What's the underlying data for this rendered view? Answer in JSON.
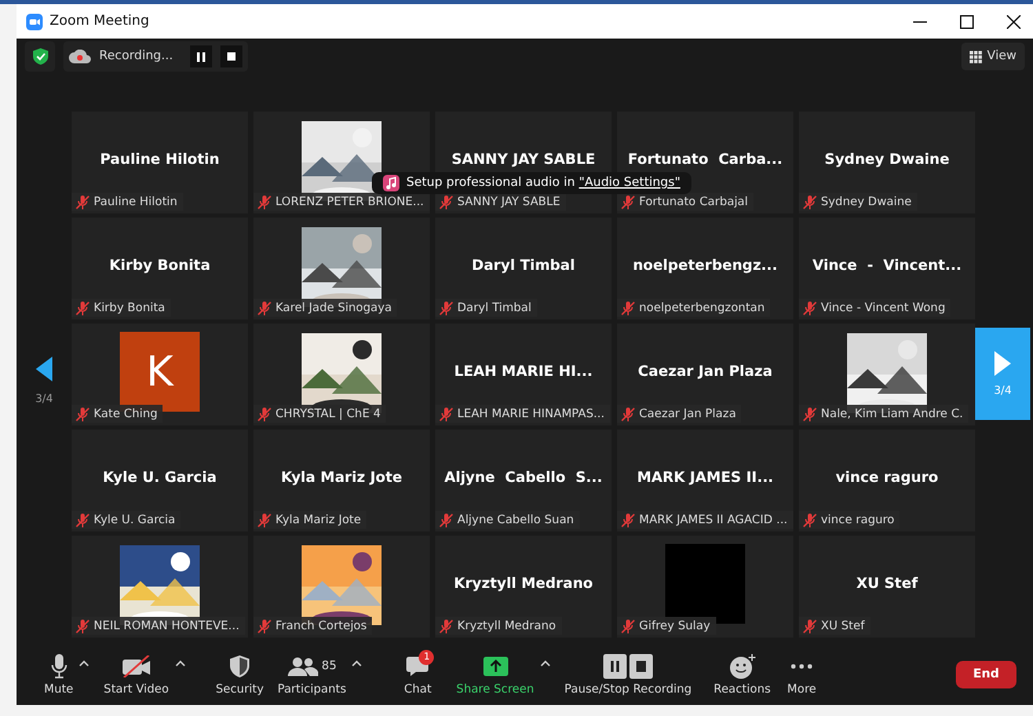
{
  "window": {
    "title": "Zoom Meeting"
  },
  "top_bar": {
    "recording": "Recording...",
    "view": "View"
  },
  "tooltip": {
    "text": "Setup professional audio in ",
    "link": "\"Audio Settings\""
  },
  "pager": {
    "left": "3/4",
    "right": "3/4"
  },
  "tiles": [
    {
      "kind": "name",
      "display_name": "Pauline Hilotin",
      "label": "Pauline Hilotin",
      "muted": true
    },
    {
      "kind": "picture",
      "label": "LORENZ PETER BRIONE...",
      "muted": true
    },
    {
      "kind": "name",
      "display_name": "SANNY JAY SABLE",
      "label": "SANNY JAY SABLE",
      "muted": true
    },
    {
      "kind": "name",
      "display_name": "Fortunato  Carba...",
      "label": "Fortunato Carbajal",
      "muted": true
    },
    {
      "kind": "name",
      "display_name": "Sydney Dwaine",
      "label": "Sydney Dwaine",
      "muted": true
    },
    {
      "kind": "name",
      "display_name": "Kirby Bonita",
      "label": "Kirby Bonita",
      "muted": true
    },
    {
      "kind": "picture",
      "label": "Karel Jade Sinogaya",
      "muted": true
    },
    {
      "kind": "name",
      "display_name": "Daryl Timbal",
      "label": "Daryl Timbal",
      "muted": true
    },
    {
      "kind": "name",
      "display_name": "noelpeterbengz...",
      "label": "noelpeterbengzontan",
      "muted": true
    },
    {
      "kind": "name",
      "display_name": "Vince  -  Vincent...",
      "label": "Vince - Vincent Wong",
      "muted": true
    },
    {
      "kind": "letter",
      "avatar_letter": "K",
      "label": "Kate Ching",
      "muted": true
    },
    {
      "kind": "picture",
      "label": "CHRYSTAL | ChE 4",
      "muted": true
    },
    {
      "kind": "name",
      "display_name": "LEAH MARIE HI...",
      "label": "LEAH MARIE HINAMPAS...",
      "muted": true
    },
    {
      "kind": "name",
      "display_name": "Caezar Jan Plaza",
      "label": "Caezar Jan Plaza",
      "muted": true
    },
    {
      "kind": "picture",
      "label": "Nale, Kim Liam Andre C.",
      "muted": true
    },
    {
      "kind": "name",
      "display_name": "Kyle U. Garcia",
      "label": "Kyle U. Garcia",
      "muted": true
    },
    {
      "kind": "name",
      "display_name": "Kyla Mariz Jote",
      "label": "Kyla Mariz Jote",
      "muted": true
    },
    {
      "kind": "name",
      "display_name": "Aljyne  Cabello  S...",
      "label": "Aljyne Cabello Suan",
      "muted": true
    },
    {
      "kind": "name",
      "display_name": "MARK JAMES II...",
      "label": "MARK JAMES II AGACID ...",
      "muted": true
    },
    {
      "kind": "name",
      "display_name": "vince raguro",
      "label": "vince raguro",
      "muted": true
    },
    {
      "kind": "picture",
      "label": "NEIL ROMAN HONTEVE...",
      "muted": true
    },
    {
      "kind": "picture",
      "label": "Franch Cortejos",
      "muted": true
    },
    {
      "kind": "name",
      "display_name": "Kryztyll Medrano",
      "label": "Kryztyll Medrano",
      "muted": true
    },
    {
      "kind": "blank",
      "label": "Gifrey Sulay",
      "muted": true
    },
    {
      "kind": "name",
      "display_name": "XU Stef",
      "label": "XU Stef",
      "muted": true
    }
  ],
  "toolbar": [
    {
      "kind": "mute",
      "label": "Mute",
      "caret": true
    },
    {
      "kind": "video",
      "label": "Start Video",
      "caret": true
    },
    {
      "kind": "security",
      "label": "Security",
      "caret": false
    },
    {
      "kind": "participants",
      "label": "Participants",
      "count": "85",
      "caret": true
    },
    {
      "kind": "chat",
      "label": "Chat",
      "badge": "1",
      "caret": false
    },
    {
      "kind": "share",
      "label": "Share Screen",
      "caret": true
    },
    {
      "kind": "record",
      "label": "Pause/Stop Recording",
      "caret": false
    },
    {
      "kind": "reactions",
      "label": "Reactions",
      "caret": false
    },
    {
      "kind": "more",
      "label": "More",
      "caret": false
    }
  ],
  "end_button": "End"
}
